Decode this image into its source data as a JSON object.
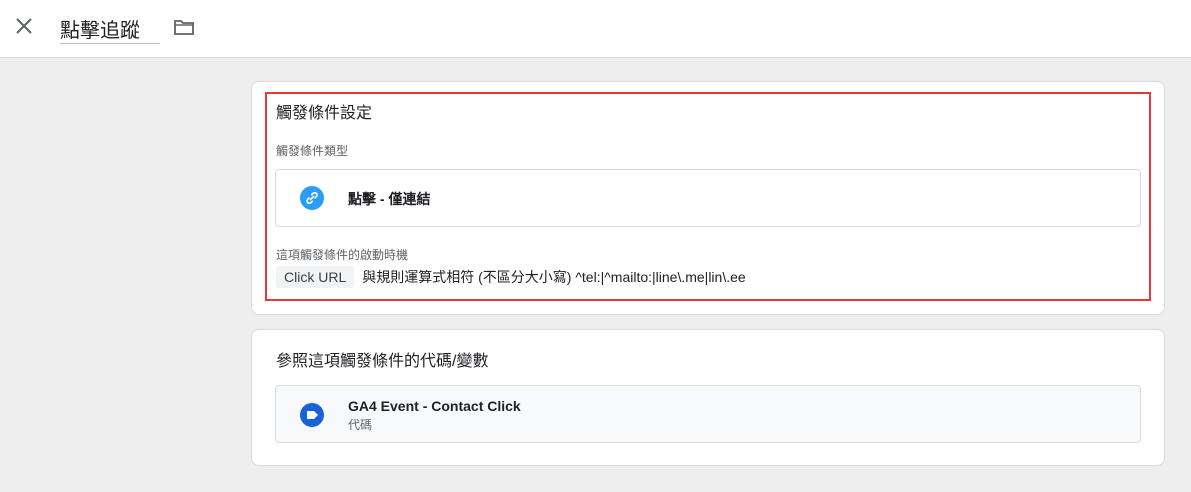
{
  "header": {
    "title": "點擊追蹤",
    "close_icon": "close-icon",
    "folder_icon": "folder-icon"
  },
  "trigger_config": {
    "title": "觸發條件設定",
    "type_label": "觸發條件類型",
    "type_value": "點擊 - 僅連結",
    "type_icon": "link-icon",
    "fires_on_label": "這項觸發條件的啟動時機",
    "condition_variable": "Click URL",
    "condition_text": "與規則運算式相符 (不區分大小寫) ^tel:|^mailto:|line\\.me|lin\\.ee"
  },
  "references": {
    "title": "參照這項觸發條件的代碼/變數",
    "items": [
      {
        "name": "GA4 Event - Contact Click",
        "kind": "代碼",
        "icon": "tag-icon"
      }
    ]
  },
  "colors": {
    "highlight": "#e53935",
    "link_icon": "#2a9df4",
    "tag_icon": "#1a62d6"
  }
}
